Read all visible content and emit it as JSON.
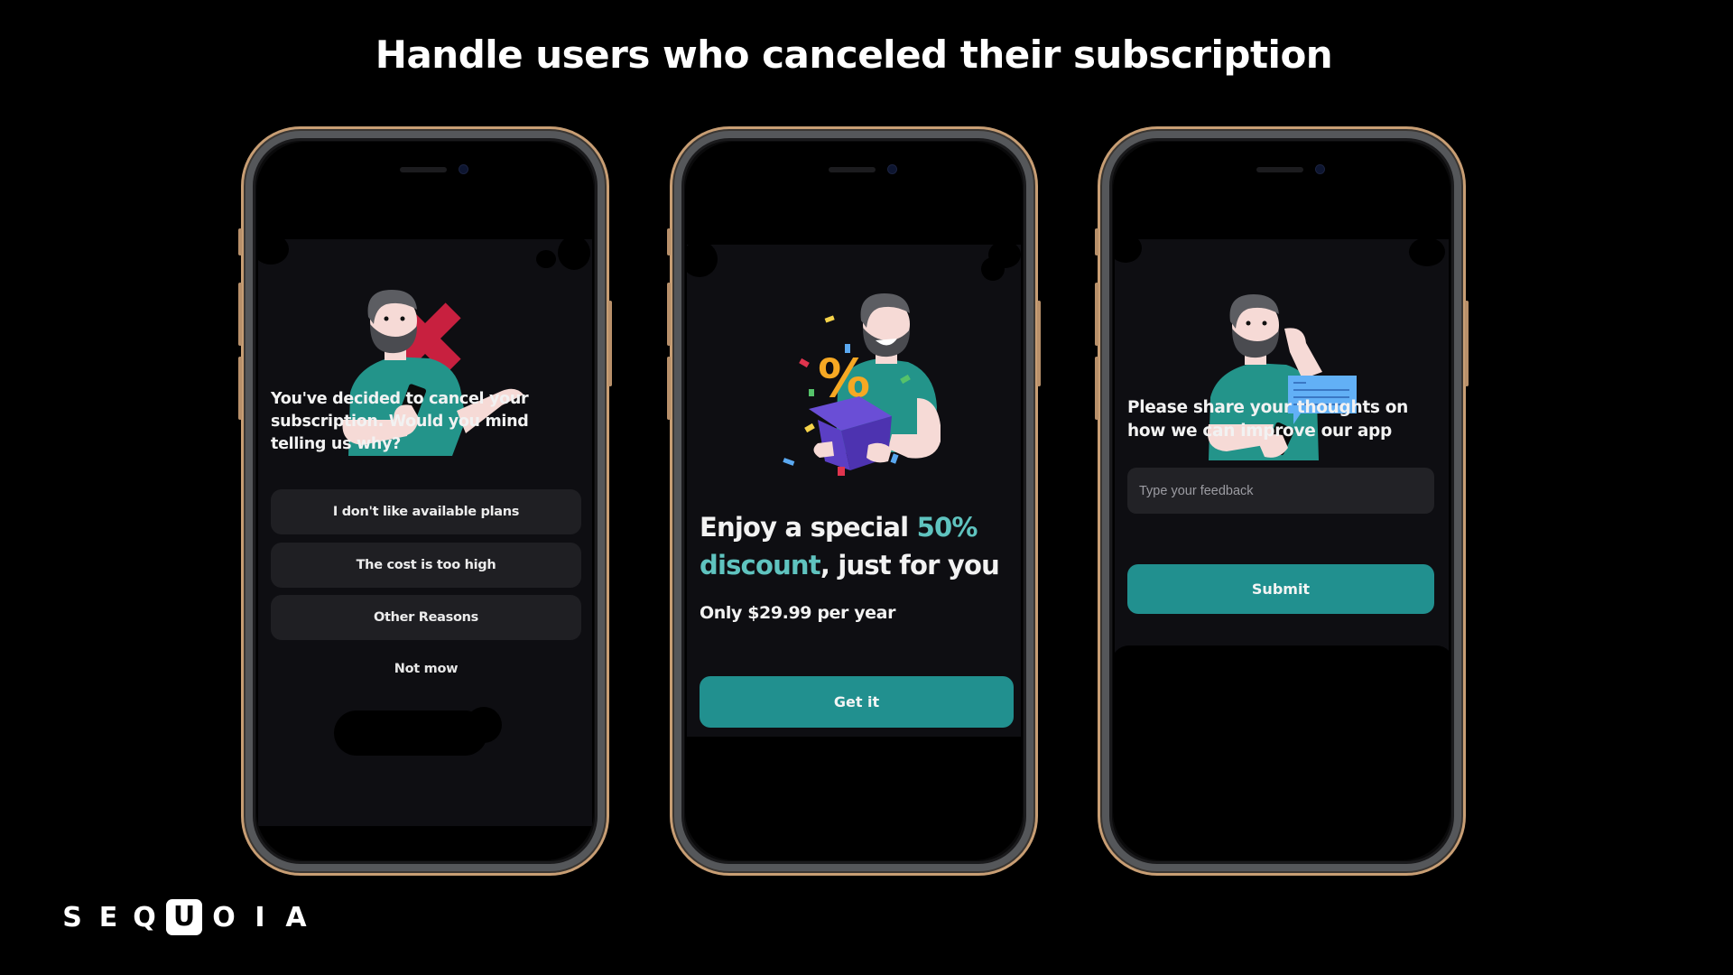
{
  "slide": {
    "title": "Handle users who canceled their subscription",
    "brand": {
      "letters": [
        "S",
        "E",
        "Q",
        "U",
        "O",
        "I",
        "A"
      ],
      "highlighted_letter_index": 3,
      "name": "SEQUOIA"
    }
  },
  "colors": {
    "background": "#000000",
    "screen_bg": "#0e0e12",
    "option_bg": "#1f1f23",
    "accent_teal": "#21908f",
    "accent_text": "#5fc3bf",
    "frame_gold": "#c89e74",
    "shirt_teal": "#23948a",
    "x_red": "#c8203f",
    "box_purple": "#5b3fc4",
    "percent_orange": "#f6a823",
    "bubble_blue": "#62b0f6"
  },
  "phones": [
    {
      "illustration": "man-holding-phone-with-red-x-icon",
      "heading": "You've decided to cancel your subscription. Would you mind telling us why?",
      "options": [
        "I don't like available plans",
        "The cost is too high",
        "Other Reasons"
      ],
      "dismiss_label": "Not mow"
    },
    {
      "illustration": "man-with-gift-box-percent-confetti-icon",
      "heading_parts": [
        "Enjoy a special ",
        "50% discount",
        ", just for you"
      ],
      "heading_line1_plain": "Enjoy a special ",
      "heading_line1_accent": "50%",
      "heading_line2_accent": "discount",
      "heading_line2_plain": ", just for you",
      "price_text": "Only $29.99 per year",
      "cta_label": "Get it"
    },
    {
      "illustration": "man-thinking-with-speech-bubble-icon",
      "heading": "Please share your thoughts on how we can improve our app",
      "feedback_placeholder": "Type your feedback",
      "feedback_value": "",
      "cta_label": "Submit"
    }
  ]
}
